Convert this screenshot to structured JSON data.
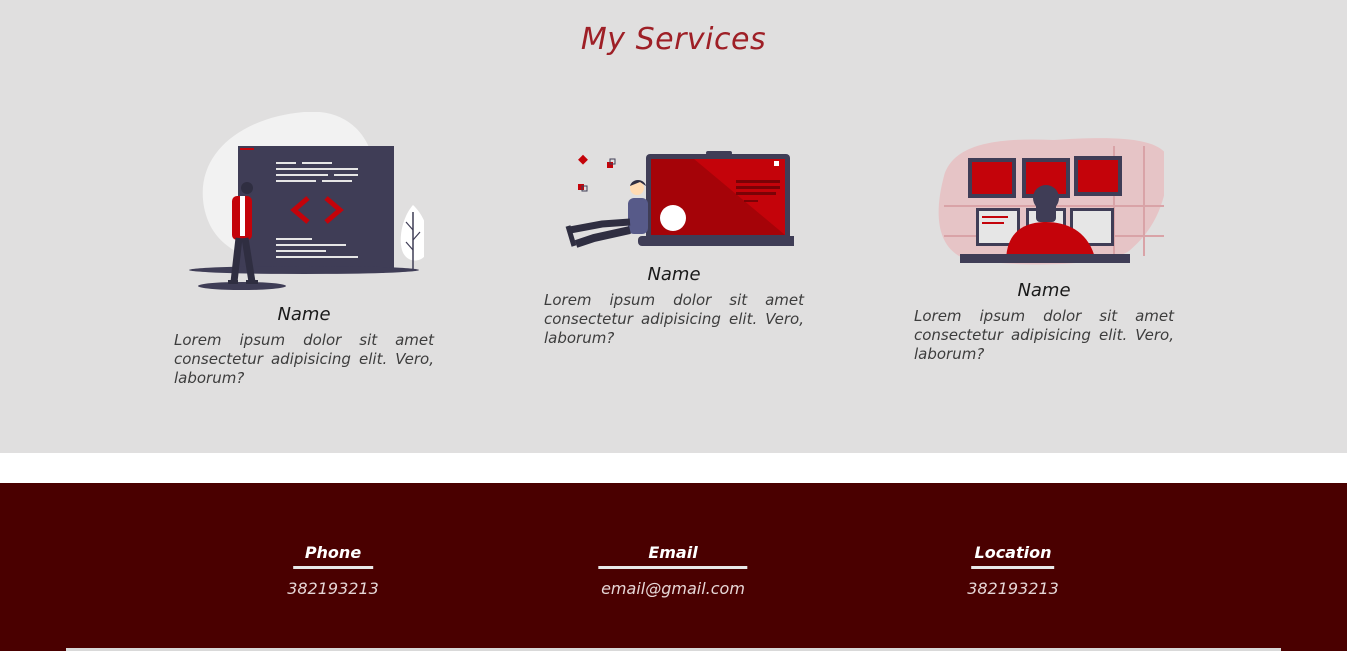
{
  "services": {
    "title": "My Services",
    "cards": [
      {
        "name": "Name",
        "description": "Lorem ipsum dolor sit amet consectetur adipisicing elit. Vero, laborum?",
        "illustration": "web-developer-illustration"
      },
      {
        "name": "Name",
        "description": "Lorem ipsum dolor sit amet consectetur adipisicing elit. Vero, laborum?",
        "illustration": "laptop-person-illustration"
      },
      {
        "name": "Name",
        "description": "Lorem ipsum dolor sit amet consectetur adipisicing elit. Vero, laborum?",
        "illustration": "monitors-workstation-illustration"
      }
    ]
  },
  "footer": {
    "contacts": [
      {
        "title": "Phone",
        "value": "382193213"
      },
      {
        "title": "Email",
        "value": "email@gmail.com"
      },
      {
        "title": "Location",
        "value": "382193213"
      }
    ]
  },
  "colors": {
    "services_bg": "#e0dfdf",
    "accent_red": "#c4030a",
    "title_red": "#9e1f26",
    "footer_bg": "#4a0000",
    "dark_navy": "#3f3d56"
  }
}
